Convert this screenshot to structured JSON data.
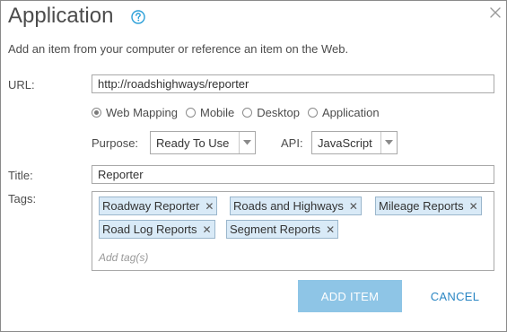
{
  "dialog": {
    "title": "Application",
    "help_icon": "question-circle-icon",
    "close_icon": "close-x-icon",
    "subtitle": "Add an item from your computer or reference an item on the Web."
  },
  "url": {
    "label": "URL:",
    "value": "http://roadshighways/reporter"
  },
  "type_options": [
    {
      "label": "Web Mapping",
      "checked": true
    },
    {
      "label": "Mobile",
      "checked": false
    },
    {
      "label": "Desktop",
      "checked": false
    },
    {
      "label": "Application",
      "checked": false
    }
  ],
  "purpose": {
    "label": "Purpose:",
    "value": "Ready To Use"
  },
  "api": {
    "label": "API:",
    "value": "JavaScript"
  },
  "title_field": {
    "label": "Title:",
    "value": "Reporter"
  },
  "tags": {
    "label": "Tags:",
    "items": [
      "Roadway Reporter",
      "Roads and Highways",
      "Mileage Reports",
      "Road Log Reports",
      "Segment Reports"
    ],
    "placeholder": "Add tag(s)"
  },
  "buttons": {
    "add": "ADD ITEM",
    "cancel": "CANCEL"
  },
  "colors": {
    "accent": "#2a86c3",
    "add_button_bg": "#8ec5e6",
    "tag_bg": "#d9eaf7",
    "help_icon": "#2a9fd8"
  }
}
